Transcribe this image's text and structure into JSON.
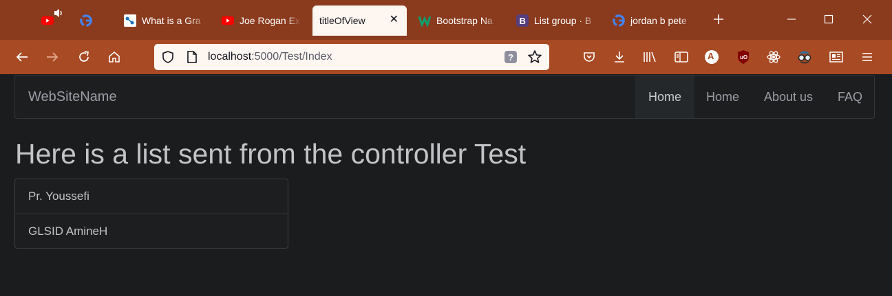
{
  "browser": {
    "tabs": [
      {
        "title": "",
        "icon": "youtube-icon"
      },
      {
        "title": "",
        "icon": "google-icon"
      },
      {
        "title": "What is a Gra",
        "icon": "site-icon"
      },
      {
        "title": "Joe Rogan Ex",
        "icon": "youtube-icon"
      },
      {
        "title": "titleOfView",
        "icon": "",
        "active": true
      },
      {
        "title": "Bootstrap Na",
        "icon": "w-icon"
      },
      {
        "title": "List group · B",
        "icon": "bootstrap-icon"
      },
      {
        "title": "jordan b pete",
        "icon": "google-icon"
      }
    ],
    "url_scheme_host": "localhost",
    "url_rest": ":5000/Test/Index",
    "avatar_letter": "A",
    "colors": {
      "tabstrip": "#8a3a1d",
      "toolbar": "#a84a24",
      "urlbar": "#fdf6f1"
    }
  },
  "site": {
    "brand": "WebSiteName",
    "nav": [
      "Home",
      "Home",
      "About us",
      "FAQ"
    ]
  },
  "main": {
    "heading": "Here is a list sent from the controller Test",
    "list": [
      "Pr. Youssefi",
      "GLSID AmineH"
    ]
  }
}
